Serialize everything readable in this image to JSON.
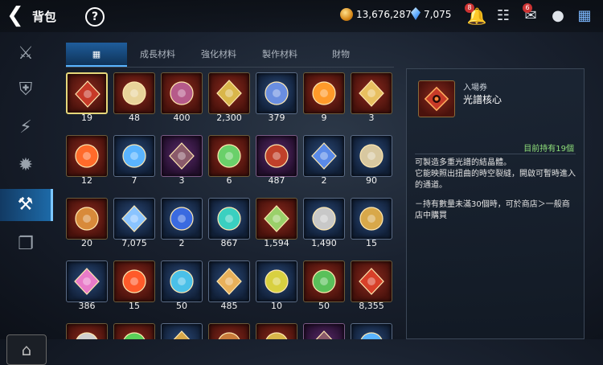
{
  "header": {
    "back_icon": "chevron-left",
    "title": "背包",
    "help_label": "?",
    "gold": "13,676,287",
    "crystal": "7,075",
    "bell_badge": "8",
    "mail_badge": "6"
  },
  "sidebar": {
    "items": [
      "sword-icon",
      "shield-icon",
      "lightning-icon",
      "burst-icon",
      "bag-icon",
      "chest-icon"
    ],
    "active_index": 4,
    "bottom": "home-icon"
  },
  "tabs": [
    "▦",
    "成長材料",
    "強化材料",
    "製作材料",
    "財物"
  ],
  "items": [
    {
      "count": "19",
      "icon": "red-core",
      "tint": "#c73a28"
    },
    {
      "count": "48",
      "icon": "sun-medal",
      "tint": "#e8d39a"
    },
    {
      "count": "400",
      "icon": "crystal-orb",
      "tint": "#b65a8a"
    },
    {
      "count": "2,300",
      "icon": "eye-emblem",
      "tint": "#d9b64a"
    },
    {
      "count": "379",
      "icon": "eye-emblem-blue",
      "tint": "#6a8ee0"
    },
    {
      "count": "9",
      "icon": "flame-shard",
      "tint": "#ff9a2a"
    },
    {
      "count": "3",
      "icon": "ticket",
      "tint": "#e8c060"
    },
    {
      "count": "12",
      "icon": "fire-stone",
      "tint": "#ff6a2a"
    },
    {
      "count": "7",
      "icon": "blue-drop",
      "tint": "#5ab4ff"
    },
    {
      "count": "3",
      "icon": "dark-orb",
      "tint": "#8a5a6a"
    },
    {
      "count": "6",
      "icon": "green-leaf",
      "tint": "#6ad06a"
    },
    {
      "count": "487",
      "icon": "red-cross-orb",
      "tint": "#c0402a"
    },
    {
      "count": "2",
      "icon": "blue-ticket",
      "tint": "#5a8ae8"
    },
    {
      "count": "90",
      "icon": "scroll-paper",
      "tint": "#d8c8a0"
    },
    {
      "count": "20",
      "icon": "flame-medal",
      "tint": "#d88a3a"
    },
    {
      "count": "7,075",
      "icon": "blue-crystal",
      "tint": "#8ac4ff"
    },
    {
      "count": "2",
      "icon": "blue-cluster",
      "tint": "#3a6ae0"
    },
    {
      "count": "867",
      "icon": "teal-crystal",
      "tint": "#3ad0c0"
    },
    {
      "count": "1,594",
      "icon": "green-feather",
      "tint": "#9ad06a"
    },
    {
      "count": "1,490",
      "icon": "star-coin",
      "tint": "#c8c8c8"
    },
    {
      "count": "15",
      "icon": "gold-coin",
      "tint": "#d8a84a"
    },
    {
      "count": "386",
      "icon": "pink-crystals",
      "tint": "#e87ac8"
    },
    {
      "count": "15",
      "icon": "fire-stone",
      "tint": "#ff5a2a"
    },
    {
      "count": "50",
      "icon": "blue-drop",
      "tint": "#4ac0e8"
    },
    {
      "count": "485",
      "icon": "star-shard",
      "tint": "#e8b05a"
    },
    {
      "count": "10",
      "icon": "card",
      "tint": "#d8d040"
    },
    {
      "count": "50",
      "icon": "green-leaf",
      "tint": "#5ac05a"
    },
    {
      "count": "8,355",
      "icon": "red-ring",
      "tint": "#d8402a"
    },
    {
      "count": "",
      "icon": "shard",
      "tint": "#d0d0d0"
    },
    {
      "count": "",
      "icon": "clover",
      "tint": "#5ad05a"
    },
    {
      "count": "",
      "icon": "gold-coin",
      "tint": "#d8a84a"
    },
    {
      "count": "",
      "icon": "gear",
      "tint": "#c87a3a"
    },
    {
      "count": "",
      "icon": "eye-emblem",
      "tint": "#d9b64a"
    },
    {
      "count": "",
      "icon": "dark-orb",
      "tint": "#8a5a6a"
    },
    {
      "count": "",
      "icon": "blue-drop",
      "tint": "#5ab4ff"
    }
  ],
  "detail": {
    "type": "入場券",
    "name": "光譜核心",
    "owned": "目前持有19個",
    "desc1": "可製造多重光譜的結晶體。\n它能映照出扭曲的時空裂縫，開啟可暫時進入的通道。",
    "desc2": "－持有數量未滿30個時，可於商店＞一般商店中購買"
  }
}
